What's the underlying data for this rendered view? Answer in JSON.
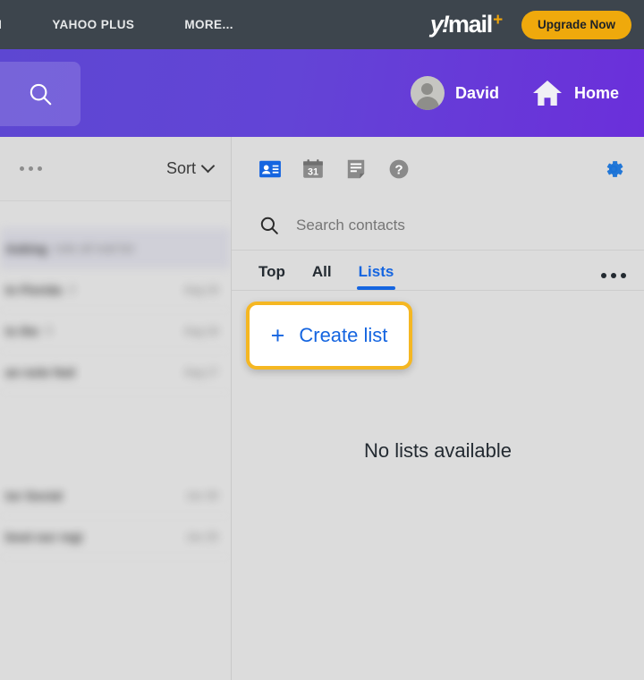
{
  "topbar": {
    "nav_items": [
      {
        "label": "CH",
        "name": "topnav-search"
      },
      {
        "label": "YAHOO PLUS",
        "name": "topnav-yahoo-plus"
      },
      {
        "label": "MORE...",
        "name": "topnav-more"
      }
    ],
    "logo": {
      "y": "y!",
      "mail": "mail",
      "plus": "+"
    },
    "upgrade_label": "Upgrade Now",
    "colors": {
      "bar": "#3d454d",
      "upgrade": "#efa90c",
      "logo_plus": "#f0a50a"
    }
  },
  "purplebar": {
    "search_icon": "search-icon",
    "user_name": "David",
    "home_label": "Home",
    "colors": {
      "left": "#5d47d2",
      "right": "#6b2fda"
    }
  },
  "sidebar": {
    "overflow_icon": "more-horizontal-icon",
    "sort_label": "Sort",
    "messages": [
      {
        "sender": "Asking",
        "subject": "note all mail list",
        "date": "",
        "selected": true
      },
      {
        "sender": "In Florida",
        "subject": "2",
        "date": "Aug 19",
        "selected": false
      },
      {
        "sender": "ts the",
        "subject": "5",
        "date": "Aug 18",
        "selected": false
      },
      {
        "sender": "an note fwd",
        "subject": "",
        "date": "Aug 17",
        "selected": false
      },
      {
        "sender": "",
        "subject": "",
        "date": "",
        "selected": false,
        "gap": true
      },
      {
        "sender": "tor Social",
        "subject": "",
        "date": "Jun 30",
        "selected": false
      },
      {
        "sender": "bout our regi",
        "subject": "",
        "date": "Jun 25",
        "selected": false
      }
    ]
  },
  "contacts": {
    "toolbar_icons": [
      {
        "name": "contacts-card-icon",
        "active": true
      },
      {
        "name": "calendar-icon",
        "label": "31",
        "active": false
      },
      {
        "name": "notepad-icon",
        "active": false
      },
      {
        "name": "help-icon",
        "active": false
      }
    ],
    "settings_icon": "gear-icon",
    "search": {
      "placeholder": "Search contacts",
      "icon": "search-icon"
    },
    "tabs": [
      {
        "label": "Top",
        "active": false
      },
      {
        "label": "All",
        "active": false
      },
      {
        "label": "Lists",
        "active": true
      }
    ],
    "tabs_overflow_icon": "more-horizontal-icon",
    "create_list": {
      "plus": "+",
      "label": "Create list"
    },
    "empty_state": "No lists available",
    "colors": {
      "accent_blue": "#1565e0",
      "highlight_border": "#f5b722"
    }
  }
}
